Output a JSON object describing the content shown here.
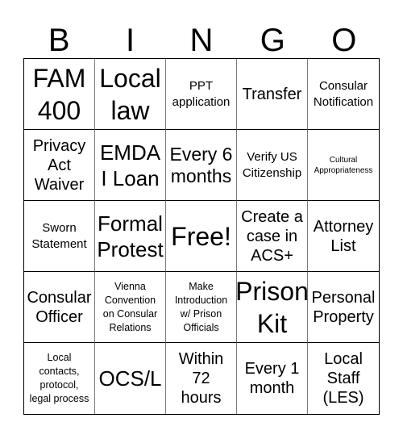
{
  "header": {
    "letters": [
      "B",
      "I",
      "N",
      "G",
      "O"
    ]
  },
  "cells": [
    {
      "text": "FAM 400",
      "lines": [
        "FAM",
        "400"
      ]
    },
    {
      "text": "Local law",
      "lines": [
        "Local",
        "law"
      ]
    },
    {
      "text": "PPT application",
      "lines": [
        "PPT",
        "application"
      ]
    },
    {
      "text": "Transfer",
      "lines": [
        "Transfer"
      ]
    },
    {
      "text": "Consular Notification",
      "lines": [
        "Consular",
        "Notification"
      ]
    },
    {
      "text": "Privacy Act Waiver",
      "lines": [
        "Privacy",
        "Act",
        "Waiver"
      ]
    },
    {
      "text": "EMDAI Loan",
      "lines": [
        "EMDA",
        "I Loan"
      ]
    },
    {
      "text": "Every 6 months",
      "lines": [
        "Every 6",
        "months"
      ]
    },
    {
      "text": "Verify US Citizenship",
      "lines": [
        "Verify US",
        "Citizenship"
      ]
    },
    {
      "text": "Cultural Appropriateness",
      "lines": [
        "Cultural",
        "Appropriateness"
      ]
    },
    {
      "text": "Sworn Statement",
      "lines": [
        "Sworn",
        "Statement"
      ]
    },
    {
      "text": "Formal Protest",
      "lines": [
        "Formal",
        "Protest"
      ]
    },
    {
      "text": "Free!",
      "lines": [
        "Free!"
      ]
    },
    {
      "text": "Create a case in ACS+",
      "lines": [
        "Create a",
        "case in",
        "ACS+"
      ]
    },
    {
      "text": "Attorney List",
      "lines": [
        "Attorney",
        "List"
      ]
    },
    {
      "text": "Consular Officer",
      "lines": [
        "Consular",
        "Officer"
      ]
    },
    {
      "text": "Vienna Convention on Consular Relations",
      "lines": [
        "Vienna",
        "Convention",
        "on Consular",
        "Relations"
      ]
    },
    {
      "text": "Make Introduction w/ Prison Officials",
      "lines": [
        "Make",
        "Introduction",
        "w/ Prison",
        "Officials"
      ]
    },
    {
      "text": "Prison Kit",
      "lines": [
        "Prison",
        "Kit"
      ]
    },
    {
      "text": "Personal Property",
      "lines": [
        "Personal",
        "Property"
      ]
    },
    {
      "text": "Local contacts, protocol, legal process",
      "lines": [
        "Local",
        "contacts,",
        "protocol,",
        "legal process"
      ]
    },
    {
      "text": "OCS/L",
      "lines": [
        "OCS/L"
      ]
    },
    {
      "text": "Within 72 hours",
      "lines": [
        "Within",
        "72",
        "hours"
      ]
    },
    {
      "text": "Every 1 month",
      "lines": [
        "Every 1",
        "month"
      ]
    },
    {
      "text": "Local Staff (LES)",
      "lines": [
        "Local",
        "Staff",
        "(LES)"
      ]
    }
  ]
}
